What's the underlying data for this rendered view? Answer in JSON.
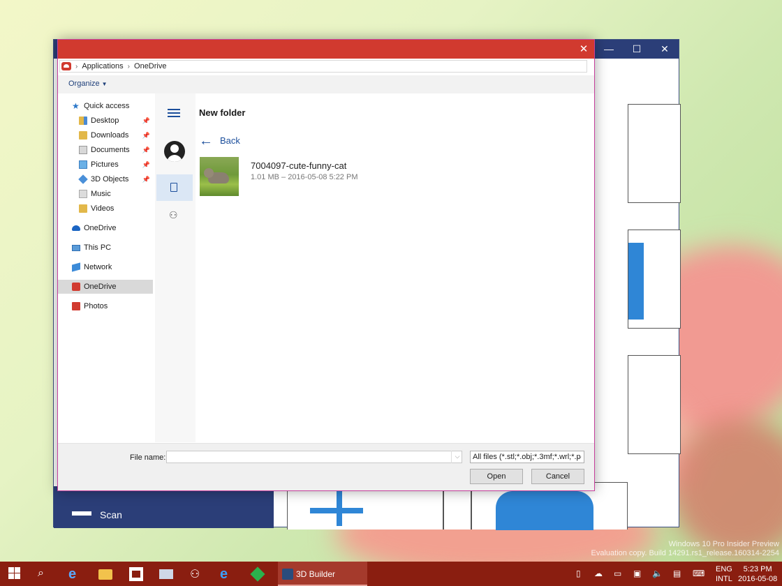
{
  "watermark": {
    "line1": "Windows 10 Pro Insider Preview",
    "line2": "Evaluation copy. Build 14291.rs1_release.160314-2254"
  },
  "background_app": {
    "title": "3D Builder",
    "scan_label": "Scan",
    "accent_color": "#2b3e78"
  },
  "dialog": {
    "title_color": "#d13a2f",
    "close_glyph": "✕",
    "breadcrumb": [
      "Applications",
      "OneDrive"
    ],
    "toolbar": {
      "organize_label": "Organize"
    },
    "nav": {
      "quick_access": "Quick access",
      "quick_items": [
        "Desktop",
        "Downloads",
        "Documents",
        "Pictures",
        "3D Objects",
        "Music",
        "Videos"
      ],
      "onedrive": "OneDrive",
      "this_pc": "This PC",
      "network": "Network",
      "onedrive_app": "OneDrive",
      "photos": "Photos"
    },
    "content": {
      "folder_title": "New folder",
      "back_label": "Back",
      "file": {
        "name": "7004097-cute-funny-cat",
        "meta": "1.01 MB – 2016-05-08 5:22 PM"
      }
    },
    "footer": {
      "file_name_label": "File name:",
      "file_name_value": "",
      "file_type": "All files (*.stl;*.obj;*.3mf;*.wrl;*.p",
      "open_label": "Open",
      "cancel_label": "Cancel"
    }
  },
  "taskbar": {
    "active_app": "3D Builder",
    "lang_line1": "ENG",
    "lang_line2": "INTL",
    "time": "5:23 PM",
    "date": "2016-05-08"
  }
}
